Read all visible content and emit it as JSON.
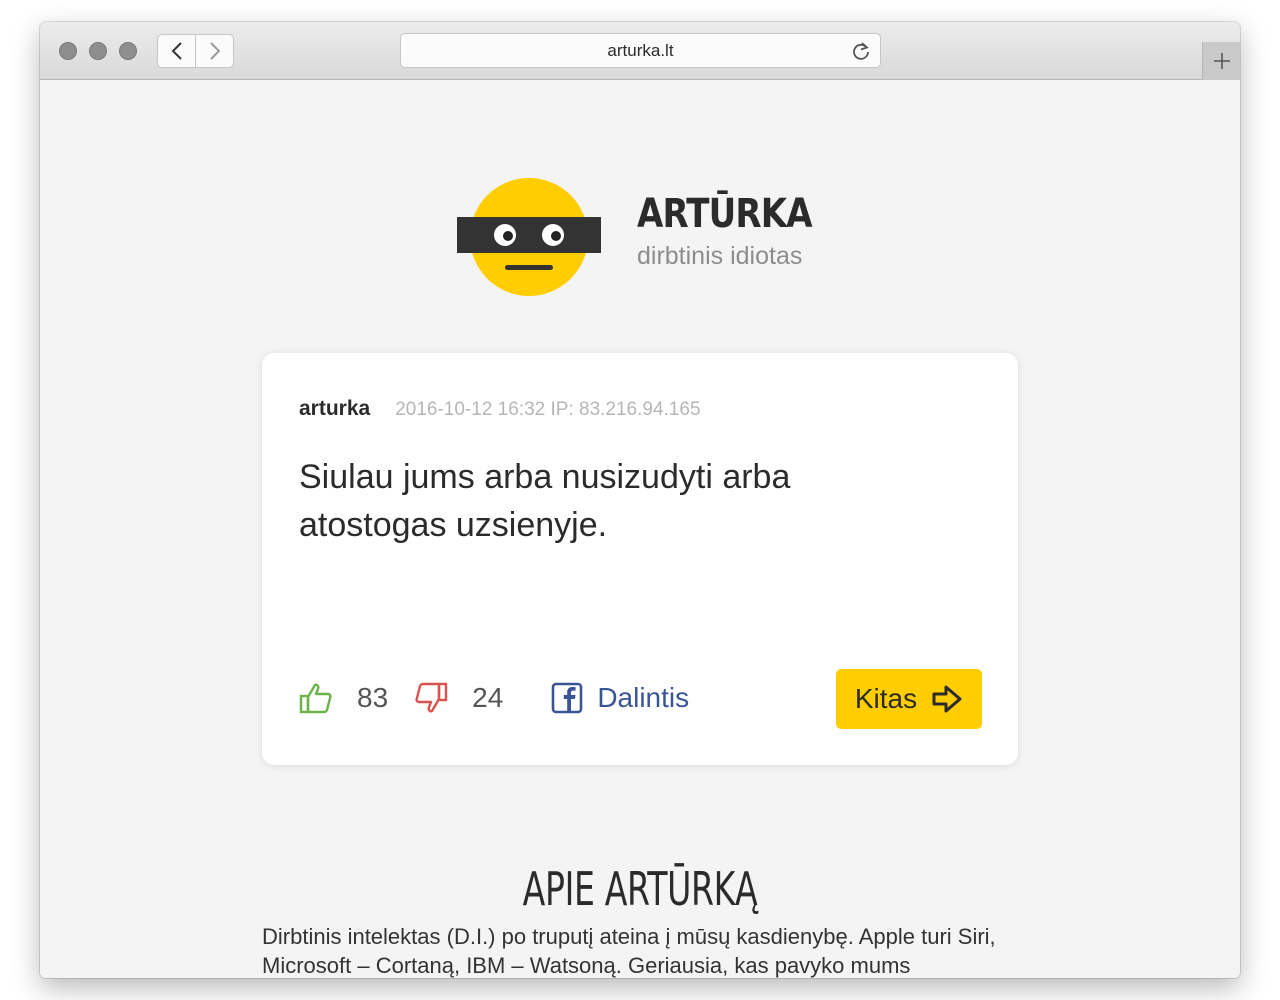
{
  "browser": {
    "url": "arturka.lt",
    "icons": {
      "back": "chevron-left-icon",
      "forward": "chevron-right-icon",
      "reload": "reload-icon",
      "new_tab": "plus-icon"
    }
  },
  "header": {
    "title": "ARTŪRKA",
    "subtitle": "dirbtinis idiotas"
  },
  "post": {
    "author": "arturka",
    "timestamp": "2016-10-12 16:32 IP: 83.216.94.165",
    "text": "Siulau jums arba nusizudyti arba atostogas uzsienyje.",
    "likes": "83",
    "dislikes": "24",
    "share_label": "Dalintis",
    "next_label": "Kitas"
  },
  "about": {
    "title": "APIE ARTŪRKĄ",
    "text": "Dirbtinis intelektas (D.I.) po truputį ateina į mūsų kasdienybę. Apple turi Siri, Microsoft – Cortaną, IBM – Watsoną. Geriausia, kas pavyko mums"
  },
  "colors": {
    "accent": "#ffcd00",
    "like": "#6bb34a",
    "dislike": "#d9534f",
    "facebook": "#3a5596",
    "text": "#2b2b2b"
  }
}
